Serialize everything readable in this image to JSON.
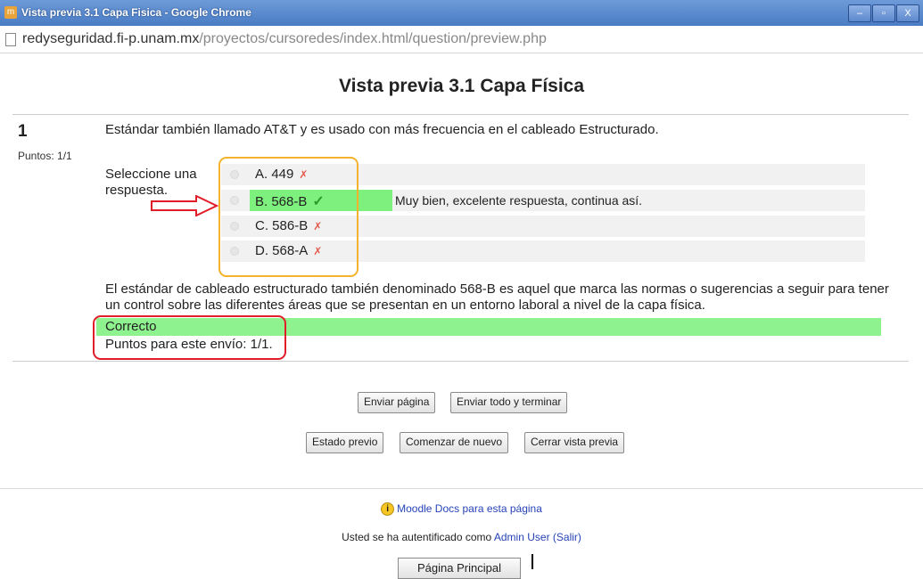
{
  "window": {
    "title": "Vista previa 3.1 Capa Fisica - Google Chrome",
    "buttons": [
      "–",
      "▫",
      "X"
    ]
  },
  "address_bar": {
    "host": "redyseguridad.fi-p.unam.mx",
    "path": "/proyectos/cursoredes/index.html/question/preview.php"
  },
  "page": {
    "title": "Vista previa 3.1 Capa Física"
  },
  "question": {
    "number": "1",
    "points": "Puntos: 1/1",
    "text": "Estándar también llamado AT&T y es usado con más frecuencia en el cableado Estructurado.",
    "prompt": "Seleccione una respuesta.",
    "options": [
      {
        "label": "A. 449",
        "mark": "✗"
      },
      {
        "label": "B. 568-B",
        "mark": "✓",
        "feedback": "Muy bien, excelente respuesta, continua así."
      },
      {
        "label": "C. 586-B",
        "mark": "✗"
      },
      {
        "label": "D. 568-A",
        "mark": "✗"
      }
    ],
    "explanation": "El estándar de cableado estructurado también denominado 568-B es aquel que marca las normas o sugerencias a seguir para tener un control sobre las diferentes áreas que se presentan en un entorno laboral a nivel de la capa física.",
    "outcome": "Correcto",
    "points_line": "Puntos para este envío: 1/1."
  },
  "buttons": {
    "submit_page": "Enviar página",
    "submit_all": "Enviar todo y terminar",
    "previous_state": "Estado previo",
    "start_again": "Comenzar de nuevo",
    "close_preview": "Cerrar vista previa"
  },
  "footer": {
    "docs_link": "Moodle Docs para esta página",
    "logged_prefix": "Usted se ha autentificado como ",
    "user": "Admin User",
    "logout": "(Salir)",
    "home_button": "Página Principal"
  },
  "colors": {
    "correct_highlight": "#7ef07e",
    "annotation_yellow": "#f5b22c",
    "annotation_red": "#e11d2a",
    "link": "#2543b7"
  }
}
